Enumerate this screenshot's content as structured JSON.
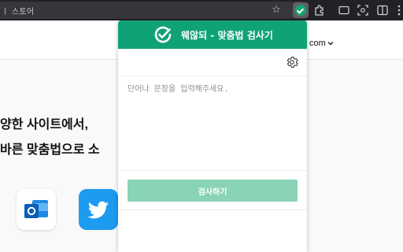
{
  "browser": {
    "address_text": "ㅣ 스토어"
  },
  "site": {
    "language_label": "com",
    "headline_line1": "양한 사이트에서,",
    "headline_line2": "바른 맞춤법으로 소"
  },
  "popup": {
    "title": "웨않되 - 맞춤법 검사기",
    "textarea_placeholder": "단어나 문장을 입력해주세요.",
    "check_button_label": "검사하기"
  },
  "colors": {
    "brand_green": "#10a277",
    "button_green_disabled": "#89d3b6"
  },
  "icons": {
    "toolbar": [
      "star-icon",
      "extension-icon",
      "puzzle-icon",
      "cast-icon",
      "screenshot-icon",
      "sidebar-icon",
      "more-icon"
    ],
    "popup": [
      "logo-check-icon",
      "gear-icon"
    ],
    "apps": [
      "outlook-icon",
      "twitter-icon"
    ]
  }
}
